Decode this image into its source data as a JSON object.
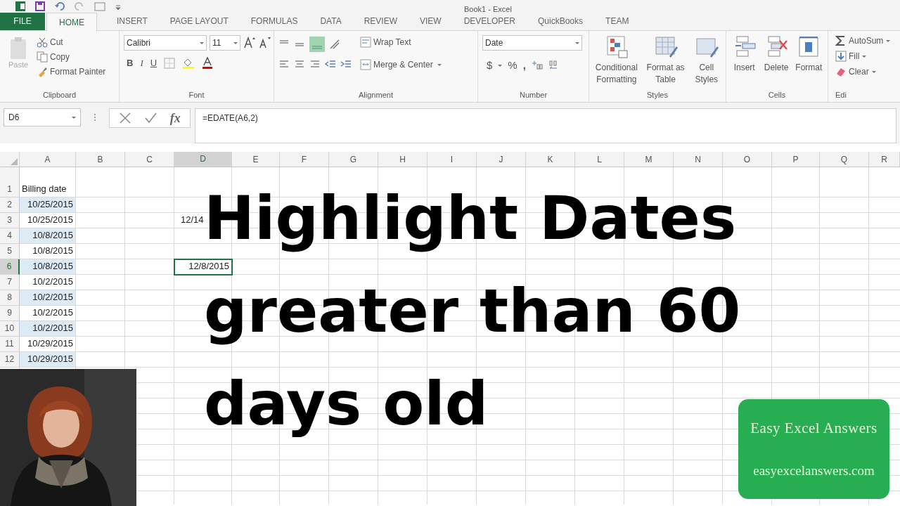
{
  "window": {
    "title": "Book1 - Excel"
  },
  "ribbon_tabs": [
    {
      "label": "FILE",
      "kind": "file",
      "selected": false
    },
    {
      "label": "HOME",
      "kind": "tab",
      "selected": true
    },
    {
      "label": "INSERT",
      "kind": "tab",
      "selected": false
    },
    {
      "label": "PAGE LAYOUT",
      "kind": "tab",
      "selected": false
    },
    {
      "label": "FORMULAS",
      "kind": "tab",
      "selected": false
    },
    {
      "label": "DATA",
      "kind": "tab",
      "selected": false
    },
    {
      "label": "REVIEW",
      "kind": "tab",
      "selected": false
    },
    {
      "label": "VIEW",
      "kind": "tab",
      "selected": false
    },
    {
      "label": "DEVELOPER",
      "kind": "tab",
      "selected": false
    },
    {
      "label": "QuickBooks",
      "kind": "tab",
      "selected": false
    },
    {
      "label": "TEAM",
      "kind": "tab",
      "selected": false
    }
  ],
  "clipboard": {
    "label": "Clipboard",
    "paste": "Paste",
    "cut": "Cut",
    "copy": "Copy",
    "format_painter": "Format Painter"
  },
  "font": {
    "label": "Font",
    "font_name": "Calibri",
    "font_size": "11",
    "bold": "B",
    "italic": "I",
    "underline": "U"
  },
  "alignment": {
    "label": "Alignment",
    "wrap_text": "Wrap Text",
    "merge_center": "Merge & Center"
  },
  "number": {
    "label": "Number",
    "format": "Date",
    "currency": "$",
    "percent": "%",
    "comma": ","
  },
  "styles": {
    "label": "Styles",
    "conditional_formatting": [
      "Conditional",
      "Formatting"
    ],
    "format_as_table": [
      "Format as",
      "Table"
    ],
    "cell_styles": [
      "Cell",
      "Styles"
    ]
  },
  "cells": {
    "label": "Cells",
    "insert": "Insert",
    "delete": "Delete",
    "format": "Format"
  },
  "editing": {
    "label": "Edi",
    "autosum": "AutoSum",
    "fill": "Fill",
    "clear": "Clear"
  },
  "formula_bar": {
    "name_box": "D6",
    "function_symbol": "fx",
    "formula": "=EDATE(A6,2)"
  },
  "sheet": {
    "columns": [
      {
        "label": "A",
        "selected": false
      },
      {
        "label": "B",
        "selected": false
      },
      {
        "label": "C",
        "selected": false
      },
      {
        "label": "D",
        "selected": true
      },
      {
        "label": "E",
        "selected": false
      },
      {
        "label": "F",
        "selected": false
      },
      {
        "label": "G",
        "selected": false
      },
      {
        "label": "H",
        "selected": false
      },
      {
        "label": "I",
        "selected": false
      },
      {
        "label": "J",
        "selected": false
      },
      {
        "label": "K",
        "selected": false
      },
      {
        "label": "L",
        "selected": false
      },
      {
        "label": "M",
        "selected": false
      },
      {
        "label": "N",
        "selected": false
      },
      {
        "label": "O",
        "selected": false
      },
      {
        "label": "P",
        "selected": false
      },
      {
        "label": "Q",
        "selected": false
      },
      {
        "label": "R",
        "selected": false
      }
    ],
    "rows": [
      {
        "number": "1",
        "selected": false,
        "a": {
          "text": "Billing date",
          "kind": "text",
          "highlighted": false
        }
      },
      {
        "number": "2",
        "selected": false,
        "a": {
          "text": "10/25/2015",
          "kind": "date",
          "highlighted": true
        }
      },
      {
        "number": "3",
        "selected": false,
        "a": {
          "text": "10/25/2015",
          "kind": "date",
          "highlighted": false
        },
        "d": {
          "text": "12/14",
          "kind": "clipped",
          "selected": false
        }
      },
      {
        "number": "4",
        "selected": false,
        "a": {
          "text": "10/8/2015",
          "kind": "date",
          "highlighted": true
        }
      },
      {
        "number": "5",
        "selected": false,
        "a": {
          "text": "10/8/2015",
          "kind": "date",
          "highlighted": false
        }
      },
      {
        "number": "6",
        "selected": true,
        "a": {
          "text": "10/8/2015",
          "kind": "date",
          "highlighted": true
        },
        "d": {
          "text": "12/8/2015",
          "kind": "date",
          "selected": true
        }
      },
      {
        "number": "7",
        "selected": false,
        "a": {
          "text": "10/2/2015",
          "kind": "date",
          "highlighted": false
        }
      },
      {
        "number": "8",
        "selected": false,
        "a": {
          "text": "10/2/2015",
          "kind": "date",
          "highlighted": true
        }
      },
      {
        "number": "9",
        "selected": false,
        "a": {
          "text": "10/2/2015",
          "kind": "date",
          "highlighted": false
        }
      },
      {
        "number": "10",
        "selected": false,
        "a": {
          "text": "10/2/2015",
          "kind": "date",
          "highlighted": true
        }
      },
      {
        "number": "11",
        "selected": false,
        "a": {
          "text": "10/29/2015",
          "kind": "date",
          "highlighted": false
        }
      },
      {
        "number": "12",
        "selected": false,
        "a": {
          "text": "10/29/2015",
          "kind": "date",
          "highlighted": true
        }
      }
    ]
  },
  "overlay_title_lines": [
    "Highlight Dates",
    "greater than 60",
    "days old"
  ],
  "badge": {
    "title": "Easy Excel Answers",
    "url": "easyexcelanswers.com"
  }
}
